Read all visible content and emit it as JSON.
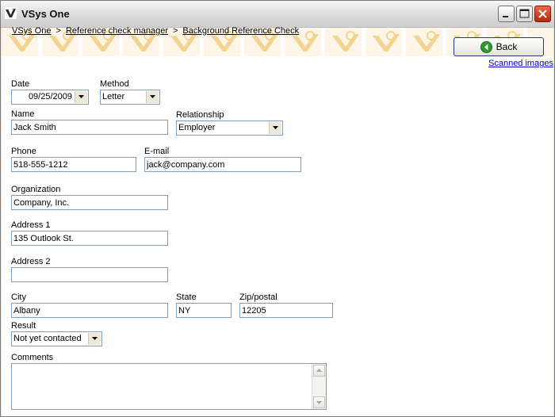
{
  "window": {
    "title": "VSys One",
    "controls": {
      "minimize": "minimize",
      "maximize": "maximize",
      "close": "close"
    }
  },
  "breadcrumb": {
    "items": [
      "VSys One",
      "Reference check manager",
      "Background Reference Check"
    ],
    "separator": ">"
  },
  "actions": {
    "back_label": "Back",
    "scanned_images_label": "Scanned images"
  },
  "form": {
    "date": {
      "label": "Date",
      "value": "09/25/2009"
    },
    "method": {
      "label": "Method",
      "value": "Letter"
    },
    "name": {
      "label": "Name",
      "value": "Jack Smith"
    },
    "relationship": {
      "label": "Relationship",
      "value": "Employer"
    },
    "phone": {
      "label": "Phone",
      "value": "518-555-1212"
    },
    "email": {
      "label": "E-mail",
      "value": "jack@company.com"
    },
    "organization": {
      "label": "Organization",
      "value": "Company, Inc."
    },
    "address1": {
      "label": "Address 1",
      "value": "135 Outlook St."
    },
    "address2": {
      "label": "Address 2",
      "value": ""
    },
    "city": {
      "label": "City",
      "value": "Albany"
    },
    "state": {
      "label": "State",
      "value": "NY"
    },
    "zip": {
      "label": "Zip/postal",
      "value": "12205"
    },
    "result": {
      "label": "Result",
      "value": "Not yet contacted"
    },
    "comments": {
      "label": "Comments",
      "value": ""
    }
  },
  "colors": {
    "link": "#0000cc",
    "input_border": "#7f9db9",
    "banner": "#fdf6e8",
    "banner_mark": "#f3d38f",
    "back_icon": "#2e9a2e"
  }
}
